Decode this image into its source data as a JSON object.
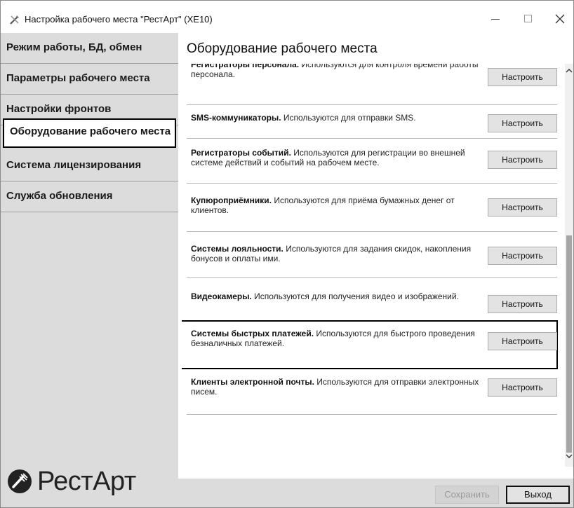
{
  "window": {
    "title": "Настройка рабочего места \"РестАрт\" (XE10)",
    "controls": {
      "minimize": "minimize",
      "maximize": "maximize",
      "close": "close"
    }
  },
  "sidebar": {
    "items": [
      {
        "label": "Режим работы, БД, обмен",
        "active": false
      },
      {
        "label": "Параметры рабочего места",
        "active": false
      },
      {
        "label": "Настройки фронтов",
        "active": false
      },
      {
        "label": "Оборудование рабочего места",
        "active": true
      },
      {
        "label": "Система лицензирования",
        "active": false
      },
      {
        "label": "Служба обновления",
        "active": false
      }
    ],
    "logo_text": "РестАрт"
  },
  "main": {
    "title": "Оборудование рабочего места",
    "rows": [
      {
        "name": "Регистраторы персонала.",
        "text": " Используются для контроля времени работы персонала.",
        "button": "Настроить"
      },
      {
        "name": "SMS-коммуникаторы.",
        "text": " Используются для отправки SMS.",
        "button": "Настроить"
      },
      {
        "name": "Регистраторы событий.",
        "text": " Используются для регистрации во внешней системе действий и событий на рабочем месте.",
        "button": "Настроить"
      },
      {
        "name": "Купюроприёмники.",
        "text": " Используются для приёма бумажных денег от клиентов.",
        "button": "Настроить"
      },
      {
        "name": "Системы лояльности.",
        "text": " Используются для задания скидок, накопления бонусов и оплаты ими.",
        "button": "Настроить"
      },
      {
        "name": "Видеокамеры.",
        "text": " Используются для получения видео и изображений.",
        "button": "Настроить"
      },
      {
        "name": "Системы быстрых платежей.",
        "text": " Используются для быстрого проведения безналичных платежей.",
        "button": "Настроить"
      },
      {
        "name": "Клиенты электронной почты.",
        "text": " Используются для отправки электронных писем.",
        "button": "Настроить"
      }
    ]
  },
  "footer": {
    "save_label": "Сохранить",
    "exit_label": "Выход"
  },
  "colors": {
    "sidebar_bg": "#dcdcdc",
    "button_bg": "#e3e3e3",
    "highlight_border": "#000000"
  }
}
